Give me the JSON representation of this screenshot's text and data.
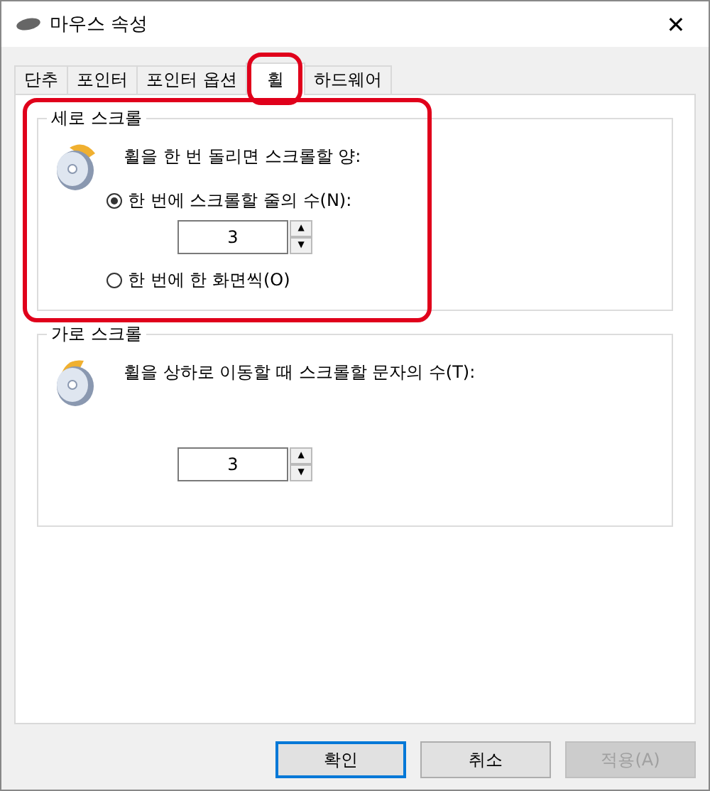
{
  "window": {
    "title": "마우스 속성",
    "close": "✕"
  },
  "tabs": [
    {
      "label": "단추",
      "selected": false,
      "highlighted": false
    },
    {
      "label": "포인터",
      "selected": false,
      "highlighted": false
    },
    {
      "label": "포인터 옵션",
      "selected": false,
      "highlighted": false
    },
    {
      "label": "휠",
      "selected": true,
      "highlighted": true
    },
    {
      "label": "하드웨어",
      "selected": false,
      "highlighted": false
    }
  ],
  "groups": [
    {
      "title": "세로 스크롤",
      "highlighted": true,
      "prompt": "휠을 한 번 돌리면 스크롤할 양:",
      "kind": "vertical",
      "options": [
        {
          "label": "한 번에 스크롤할 줄의 수(N):",
          "selected": true,
          "spin": {
            "value": "3",
            "up": "▲",
            "down": "▼"
          }
        },
        {
          "label": "한 번에 한 화면씩(O)",
          "selected": false
        }
      ]
    },
    {
      "title": "가로 스크롤",
      "highlighted": false,
      "prompt": "휠을 상하로 이동할 때 스크롤할 문자의 수(T):",
      "kind": "horizontal",
      "spin": {
        "value": "3",
        "up": "▲",
        "down": "▼"
      }
    }
  ],
  "buttons": [
    {
      "label": "확인",
      "default": true,
      "disabled": false
    },
    {
      "label": "취소",
      "default": false,
      "disabled": false
    },
    {
      "label": "적용(A)",
      "default": false,
      "disabled": true
    }
  ]
}
